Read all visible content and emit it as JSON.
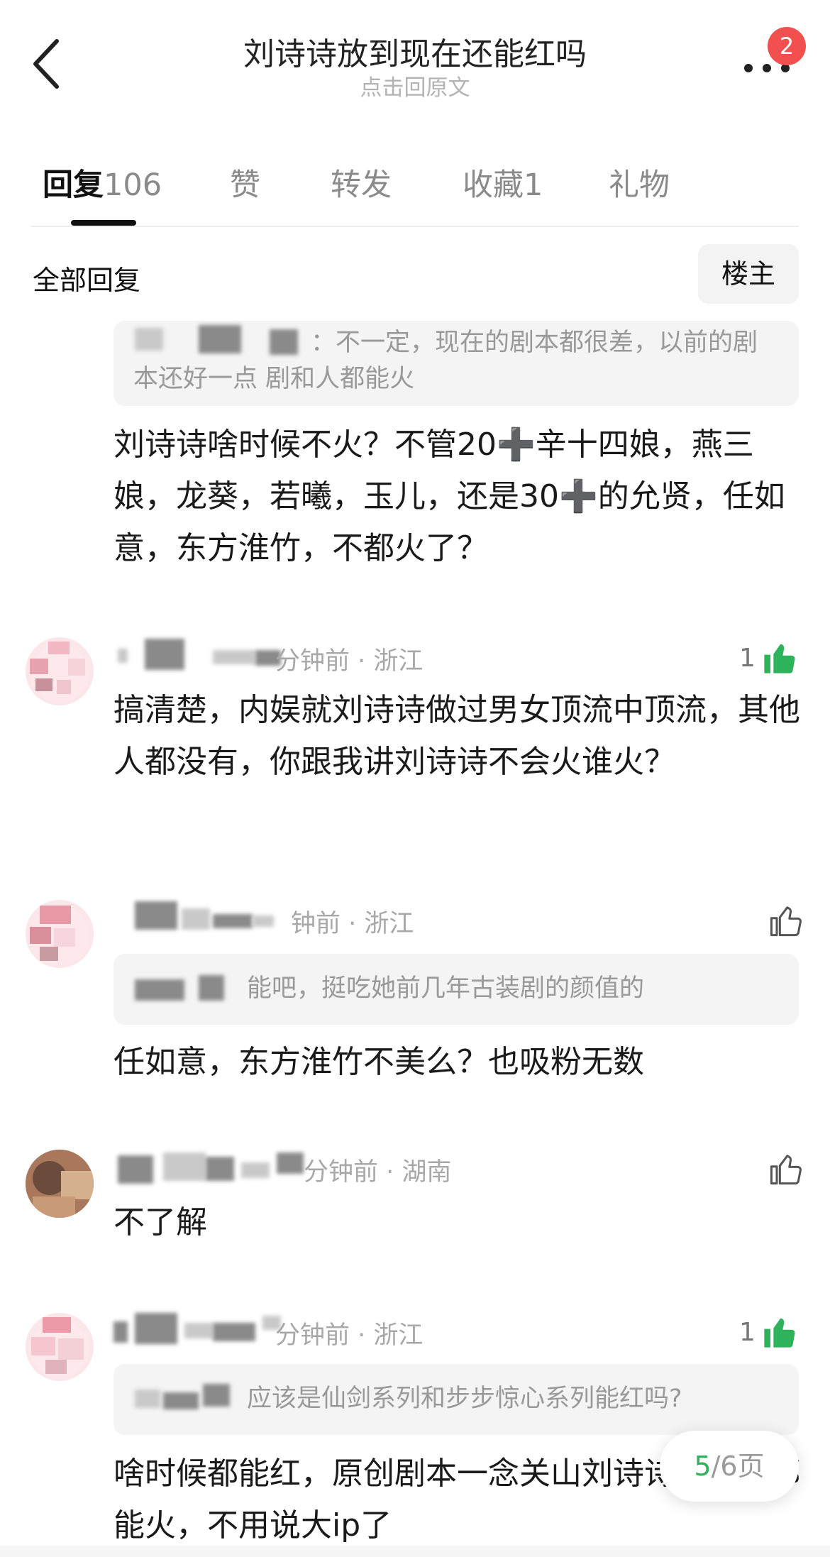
{
  "header": {
    "title": "刘诗诗放到现在还能红吗",
    "subtitle": "点击回原文",
    "more_badge": "2"
  },
  "tabs": [
    {
      "label": "回复",
      "count": "106",
      "active": true
    },
    {
      "label": "赞",
      "count": ""
    },
    {
      "label": "转发",
      "count": ""
    },
    {
      "label": "收藏",
      "count": "1"
    },
    {
      "label": "礼物",
      "count": ""
    }
  ],
  "section": {
    "title": "全部回复",
    "filter_button": "楼主"
  },
  "comments": [
    {
      "quote": "：不一定，现在的剧本都很差，以前的剧本还好一点 剧和人都能火",
      "text": "刘诗诗啥时候不火？不管20➕辛十四娘，燕三娘，龙葵，若曦，玉儿，还是30➕的允贤，任如意，东方淮竹，不都火了？"
    },
    {
      "time": "分钟前",
      "location": "浙江",
      "likes": "1",
      "liked": true,
      "text": "搞清楚，内娱就刘诗诗做过男女顶流中顶流，其他人都没有，你跟我讲刘诗诗不会火谁火？"
    },
    {
      "time": "钟前",
      "location": "浙江",
      "likes": "",
      "liked": false,
      "quote": "能吧，挺吃她前几年古装剧的颜值的",
      "text": "任如意，东方淮竹不美么？也吸粉无数"
    },
    {
      "time": "分钟前",
      "location": "湖南",
      "likes": "",
      "liked": false,
      "text": "不了解"
    },
    {
      "time": "分钟前",
      "location": "浙江",
      "likes": "1",
      "liked": true,
      "quote": "应该是仙剑系列和步步惊心系列能红吗?",
      "text": "啥时候都能红，原创剧本一念关山刘诗诗任如意都能火，不用说大ip了"
    }
  ],
  "pager": {
    "current": "5",
    "total": "/6页"
  },
  "colors": {
    "like_green": "#2fb35a",
    "badge_red": "#f24f4f"
  },
  "icons": [
    "back-arrow-icon",
    "more-dots-icon",
    "thumbs-up-icon"
  ]
}
